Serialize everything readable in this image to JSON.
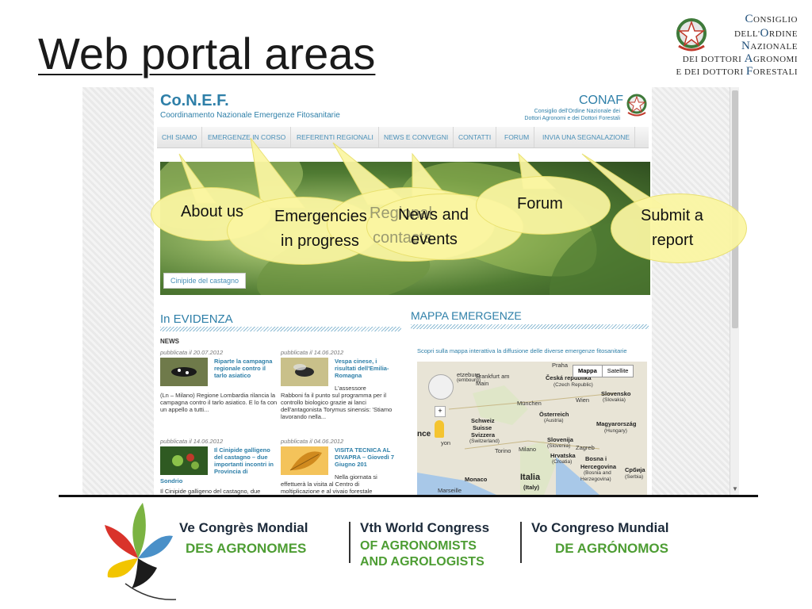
{
  "slide": {
    "title": "Web portal areas"
  },
  "conaf_logo": {
    "line1_initial": "C",
    "line1_rest": "ONSIGLIO",
    "line2_prefix": "DELL'",
    "line2_initial": "O",
    "line2_rest": "RDINE",
    "line3_initial": "N",
    "line3_rest": "AZIONALE",
    "line4_prefix": "DEI DOTTORI ",
    "line4_initial": "A",
    "line4_rest": "GRONOMI",
    "line5_prefix": "E DEI DOTTORI ",
    "line5_initial": "F",
    "line5_rest": "ORESTALI",
    "emblem_icon": "italian-republic-emblem-icon"
  },
  "site": {
    "title": "Co.N.E.F.",
    "subtitle": "Coordinamento Nazionale Emergenze Fitosanitarie",
    "brand": "CONAF",
    "brand_sub_1": "Consiglio dell'Ordine Nazionale dei",
    "brand_sub_2": "Dottori Agronomi e dei Dottori Forestali",
    "nav": [
      "CHI SIAMO",
      "EMERGENZE IN CORSO",
      "REFERENTI REGIONALI",
      "NEWS E CONVEGNI",
      "CONTATTI",
      "FORUM",
      "INVIA UNA SEGNALAZIONE"
    ],
    "hero_caption": "Cinipide del castagno",
    "evidenza_title": "In EVIDENZA",
    "news_label": "NEWS",
    "news": [
      {
        "date": "pubblicata il 20.07.2012",
        "title": "Riparte la campagna regionale contro il tarlo asiatico",
        "body": "(Ln – Milano) Regione Lombardia rilancia la campagna contro il tarlo asiatico. E lo fa con un appello a tutti..."
      },
      {
        "date": "pubblicata il 14.06.2012",
        "title": "Vespa cinese, i risultati dell'Emilia-Romagna",
        "body_inline": "L'assessore",
        "body": "Rabboni fa il punto sul programma per il controllo biologico grazie ai lanci dell'antagonista Torymus sinensis: 'Stiamo lavorando nella..."
      },
      {
        "date": "pubblicata il 14.06.2012",
        "title": "Il Cinipide galligeno del castagno – due importanti incontri in Provincia di",
        "title_tail": "Sondrio",
        "body": "Il Cinipide galligeno del castagno, due"
      },
      {
        "date": "pubblicata il 04.06.2012",
        "title": "VISITA TECNICA AL DIVAPRA – Giovedì 7 Giugno 201",
        "body_inline": "Nella giornata si",
        "body": "effettuerà la visita al Centro di moltiplicazione e al vivaio forestale"
      }
    ],
    "mappa_title": "MAPPA EMERGENZE",
    "mappa_desc": "Scopri sulla mappa interattiva la diffusione delle diverse emergenze fitosanitarie",
    "map": {
      "toggle_map": "Mappa",
      "toggle_satellite": "Satellite",
      "zoom_in": "+",
      "labels": {
        "praha": "Praha",
        "czech": "Česká republika",
        "czech_sub": "(Czech Republic)",
        "frankfurt": "Frankfurt am Main",
        "etzeburg": "etzeburg",
        "etzeburg_sub": "(embourg)",
        "munchen": "München",
        "wien": "Wien",
        "slovensko": "Slovensko",
        "slovensko_sub": "(Slovakia)",
        "osterreich": "Österreich",
        "osterreich_sub": "(Austria)",
        "schweiz": "Schweiz",
        "suisse": "Suisse",
        "svizzera": "Svizzera",
        "switzerland": "(Switzerland)",
        "nce": "nce",
        "lyon": "yon",
        "magyar": "Magyarország",
        "magyar_sub": "(Hungary)",
        "slovenija": "Slovenija",
        "slovenija_sub": "(Slovenia)",
        "zagreb": "Zagreb",
        "torino": "Torino",
        "milano": "Milano",
        "hrvatska": "Hrvatska",
        "hrvatska_sub": "(Croatia)",
        "bosna": "Bosna i",
        "hercegovina": "Hercegovina",
        "bosna_sub1": "(Bosnia and",
        "bosna_sub2": "Herzegovina)",
        "srbija": "Србија",
        "srbija_sub": "(Serbia)",
        "monaco": "Monaco",
        "italia": "Italia",
        "italy": "(Italy)",
        "marseille": "Marseille"
      }
    }
  },
  "callouts": {
    "about_us": "About us",
    "emergencies_1": "Emergencies",
    "emergencies_2": "in progress",
    "regional_1": "Regional",
    "regional_2": "contacts",
    "news_1": "News and",
    "news_2": "events",
    "forum": "Forum",
    "submit_1": "Submit a",
    "submit_2": "report"
  },
  "congress": {
    "fr_line1": "Ve Congrès Mondial",
    "fr_line2": "DES AGRONOMES",
    "en_line1": "Vth World Congress",
    "en_line2": "OF AGRONOMISTS",
    "en_line3": "AND AGROLOGISTS",
    "es_line1": "Vo Congreso Mundial",
    "es_line2": "DE AGRÓNOMOS"
  },
  "colors": {
    "link_blue": "#2e7fa8",
    "callout_yellow": "#fbf6a2",
    "congress_green": "#4d9d33",
    "congress_dark": "#1c2a3a"
  }
}
